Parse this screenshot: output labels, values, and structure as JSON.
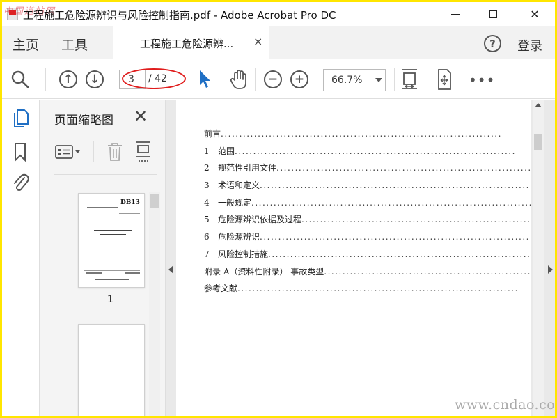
{
  "window": {
    "watermark_top": "中国道站网",
    "title": "工程施工危险源辨识与风险控制指南.pdf - Adobe Acrobat Pro DC",
    "minimize_icon": "minimize-icon",
    "maximize_icon": "maximize-icon",
    "close_glyph": "✕"
  },
  "tabbar": {
    "home": "主页",
    "tools": "工具",
    "doc_tab": "工程施工危险源辨...",
    "doc_tab_close": "×",
    "help": "?",
    "login": "登录"
  },
  "toolbar": {
    "up_glyph": "↑",
    "down_glyph": "↓",
    "page_current": "3",
    "page_total": "/ 42",
    "zoom_out_glyph": "−",
    "zoom_in_glyph": "+",
    "zoom": "66.7%",
    "more": "•••"
  },
  "thumbpanel": {
    "title": "页面缩略图",
    "close_glyph": "✕",
    "thumb_header": "DB13",
    "page_number": "1"
  },
  "toc": [
    {
      "num": "",
      "text": "前言"
    },
    {
      "num": "1",
      "text": "范围"
    },
    {
      "num": "2",
      "text": "规范性引用文件"
    },
    {
      "num": "3",
      "text": "术语和定义"
    },
    {
      "num": "4",
      "text": "一般规定"
    },
    {
      "num": "5",
      "text": "危险源辨识依据及过程"
    },
    {
      "num": "6",
      "text": "危险源辨识"
    },
    {
      "num": "7",
      "text": "风险控制措施"
    },
    {
      "num": "",
      "text": "附录 A（资料性附录）  事故类型 "
    },
    {
      "num": "",
      "text": "参考文献"
    }
  ],
  "watermark_bottom": "www.cndao.com",
  "colors": {
    "accent_blue": "#1f6fc4",
    "highlight_red": "#e01d1d",
    "frame_yellow": "#ffe600"
  }
}
